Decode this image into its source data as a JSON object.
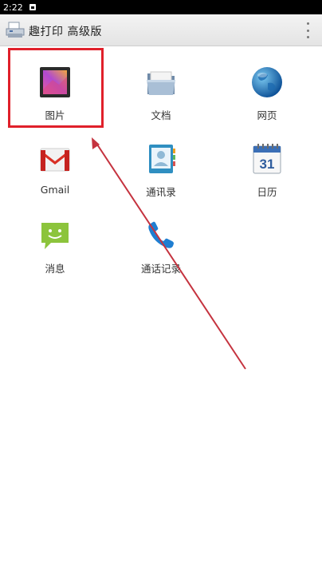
{
  "status_bar": {
    "time": "2:22"
  },
  "action_bar": {
    "title": "趣打印 高级版"
  },
  "grid": {
    "pictures": "图片",
    "documents": "文档",
    "webpages": "网页",
    "gmail": "Gmail",
    "contacts": "通讯录",
    "calendar": "日历",
    "calendar_day": "31",
    "messages": "消息",
    "call_log": "通话记录"
  },
  "colors": {
    "annotation_red": "#e0202a",
    "arrow_red": "#c5333f"
  }
}
